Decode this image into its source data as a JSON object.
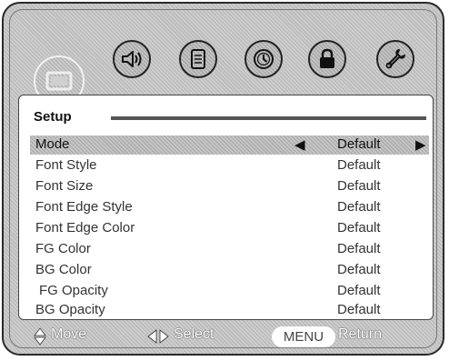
{
  "tabs": [
    {
      "name": "picture",
      "icon": "picture-icon",
      "active": true
    },
    {
      "name": "audio",
      "icon": "speaker-icon",
      "active": false
    },
    {
      "name": "document",
      "icon": "document-icon",
      "active": false
    },
    {
      "name": "time",
      "icon": "clock-icon",
      "active": false
    },
    {
      "name": "lock",
      "icon": "lock-icon",
      "active": false
    },
    {
      "name": "tools",
      "icon": "wrench-icon",
      "active": false
    }
  ],
  "panel": {
    "title": "Setup",
    "rows": [
      {
        "label": "Mode",
        "value": "Default",
        "selected": true
      },
      {
        "label": "Font Style",
        "value": "Default"
      },
      {
        "label": "Font Size",
        "value": "Default"
      },
      {
        "label": "Font Edge Style",
        "value": "Default"
      },
      {
        "label": "Font Edge Color",
        "value": "Default"
      },
      {
        "label": "FG Color",
        "value": "Default"
      },
      {
        "label": "BG Color",
        "value": "Default"
      },
      {
        "label": "FG Opacity",
        "value": "Default"
      },
      {
        "label": "BG Opacity",
        "value": "Default"
      }
    ]
  },
  "footer": {
    "move_label": "Move",
    "select_label": "Select",
    "menu_key": "MENU",
    "return_label": "Return"
  },
  "colors": {
    "frame": "#bdbdbd",
    "panel": "#ffffff",
    "selected_row": "#b0b0b0",
    "border": "#2a2a2a"
  }
}
